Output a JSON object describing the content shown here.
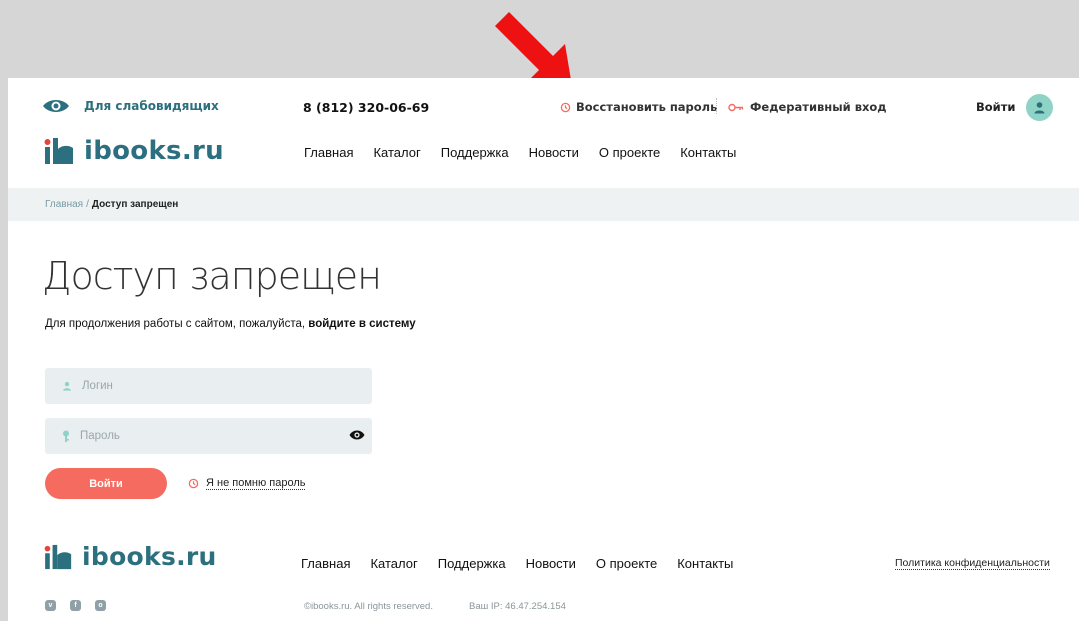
{
  "header": {
    "accessibility_label": "Для слабовидящих",
    "phone": "8 (812) 320-06-69",
    "restore_password": "Восстановить пароль",
    "federated_login": "Федеративный вход",
    "login": "Войти",
    "logo_text": "ibooks.ru"
  },
  "nav": {
    "items": [
      "Главная",
      "Каталог",
      "Поддержка",
      "Новости",
      "О проекте",
      "Контакты"
    ]
  },
  "breadcrumb": {
    "home": "Главная",
    "separator": "/",
    "current": "Доступ запрещен"
  },
  "main": {
    "title": "Доступ запрещен",
    "intro_text": "Для продолжения работы с сайтом, пожалуйста, ",
    "intro_bold": "войдите в систему",
    "login_placeholder": "Логин",
    "password_placeholder": "Пароль",
    "submit": "Войти",
    "forgot": "Я не помню пароль"
  },
  "footer": {
    "logo_text": "ibooks.ru",
    "policy": "Политика конфиденциальности",
    "copyright": "©ibooks.ru. All rights reserved.",
    "ip": "Ваш IP: 46.47.254.154",
    "socials": [
      "vk-icon",
      "facebook-icon",
      "instagram-icon"
    ]
  },
  "colors": {
    "brand": "#2c6f7e",
    "accent": "#f56b5f",
    "avatar": "#8fd3c7",
    "arrow": "#ee1111"
  }
}
